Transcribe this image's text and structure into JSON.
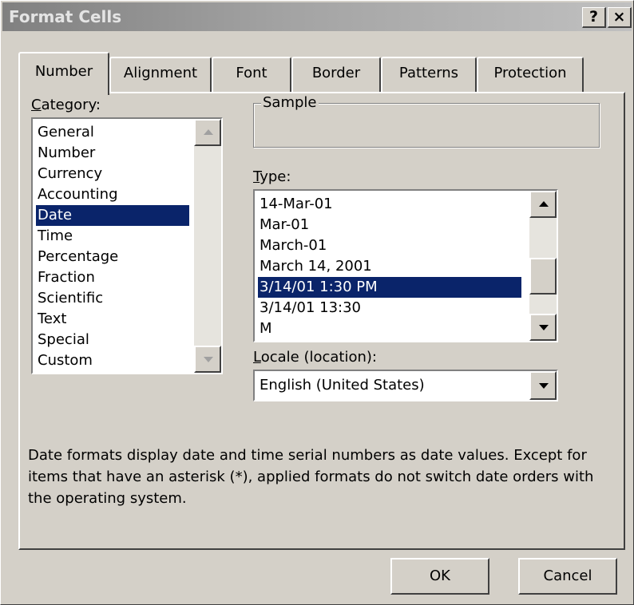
{
  "window": {
    "title": "Format Cells",
    "help_label": "?",
    "close_label": "×"
  },
  "tabs": [
    {
      "label": "Number",
      "active": true
    },
    {
      "label": "Alignment",
      "active": false
    },
    {
      "label": "Font",
      "active": false
    },
    {
      "label": "Border",
      "active": false
    },
    {
      "label": "Patterns",
      "active": false
    },
    {
      "label": "Protection",
      "active": false
    }
  ],
  "category": {
    "label": "Category:",
    "items": [
      "General",
      "Number",
      "Currency",
      "Accounting",
      "Date",
      "Time",
      "Percentage",
      "Fraction",
      "Scientific",
      "Text",
      "Special",
      "Custom"
    ],
    "selected": "Date"
  },
  "sample": {
    "label": "Sample",
    "value": ""
  },
  "type": {
    "label": "Type:",
    "items": [
      "14-Mar-01",
      "Mar-01",
      "March-01",
      "March 14, 2001",
      "3/14/01 1:30 PM",
      "3/14/01 13:30",
      "M"
    ],
    "selected": "3/14/01 1:30 PM"
  },
  "locale": {
    "label": "Locale (location):",
    "value": "English (United States)"
  },
  "description": "Date formats display date and time serial numbers as date values. Except for items that have an asterisk (*), applied formats do not switch date orders with the operating system.",
  "buttons": {
    "ok": "OK",
    "cancel": "Cancel"
  }
}
